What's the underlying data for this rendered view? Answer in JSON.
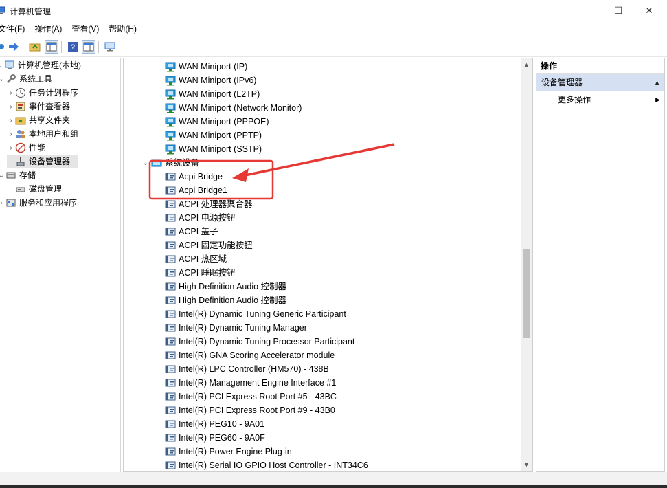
{
  "window": {
    "title": "计算机管理",
    "minimize_glyph": "—",
    "maximize_glyph": "☐",
    "close_glyph": "✕"
  },
  "menu": [
    "文件(F)",
    "操作(A)",
    "查看(V)",
    "帮助(H)"
  ],
  "toolbar": {
    "buttons": [
      "back-icon",
      "forward-icon",
      "up-folder-icon",
      "show-hide-tree-icon",
      "help-icon",
      "properties-icon",
      "monitor-icon"
    ]
  },
  "left_tree": [
    {
      "label": "计算机管理(本地)",
      "icon": "computer-management-icon",
      "level": 0,
      "expander": "⌄"
    },
    {
      "label": "系统工具",
      "icon": "system-tools-icon",
      "level": 1,
      "expander": "⌄"
    },
    {
      "label": "任务计划程序",
      "icon": "task-scheduler-icon",
      "level": 2,
      "expander": "›"
    },
    {
      "label": "事件查看器",
      "icon": "event-viewer-icon",
      "level": 2,
      "expander": "›"
    },
    {
      "label": "共享文件夹",
      "icon": "shared-folders-icon",
      "level": 2,
      "expander": "›"
    },
    {
      "label": "本地用户和组",
      "icon": "local-users-icon",
      "level": 2,
      "expander": "›"
    },
    {
      "label": "性能",
      "icon": "performance-icon",
      "level": 2,
      "expander": "›"
    },
    {
      "label": "设备管理器",
      "icon": "device-manager-icon",
      "level": 2,
      "expander": "",
      "selected": true
    },
    {
      "label": "存储",
      "icon": "storage-icon",
      "level": 1,
      "expander": "⌄"
    },
    {
      "label": "磁盘管理",
      "icon": "disk-management-icon",
      "level": 2,
      "expander": ""
    },
    {
      "label": "服务和应用程序",
      "icon": "services-icon",
      "level": 1,
      "expander": "›"
    }
  ],
  "device_list": {
    "network_items": [
      "WAN Miniport (IP)",
      "WAN Miniport (IPv6)",
      "WAN Miniport (L2TP)",
      "WAN Miniport (Network Monitor)",
      "WAN Miniport (PPPOE)",
      "WAN Miniport (PPTP)",
      "WAN Miniport (SSTP)"
    ],
    "category": "系统设备",
    "category_expander": "⌄",
    "system_items": [
      "Acpi Bridge",
      "Acpi Bridge1",
      "ACPI 处理器聚合器",
      "ACPI 电源按钮",
      "ACPI 盖子",
      "ACPI 固定功能按钮",
      "ACPI 热区域",
      "ACPI 睡眠按钮",
      "High Definition Audio 控制器",
      "High Definition Audio 控制器",
      "Intel(R) Dynamic Tuning Generic Participant",
      "Intel(R) Dynamic Tuning Manager",
      "Intel(R) Dynamic Tuning Processor Participant",
      "Intel(R) GNA Scoring Accelerator module",
      "Intel(R) LPC Controller (HM570) - 438B",
      "Intel(R) Management Engine Interface #1",
      "Intel(R) PCI Express Root Port #5 - 43BC",
      "Intel(R) PCI Express Root Port #9 - 43B0",
      "Intel(R) PEG10 - 9A01",
      "Intel(R) PEG60 - 9A0F",
      "Intel(R) Power Engine Plug-in",
      "Intel(R) Serial IO GPIO Host Controller - INT34C6"
    ]
  },
  "scrollbar": {
    "up": "▲",
    "down": "▼"
  },
  "actions": {
    "header": "操作",
    "section": "设备管理器",
    "section_glyph": "▲",
    "more": "更多操作",
    "more_glyph": "▶"
  },
  "annotation": {
    "highlight_color": "#e53935"
  }
}
